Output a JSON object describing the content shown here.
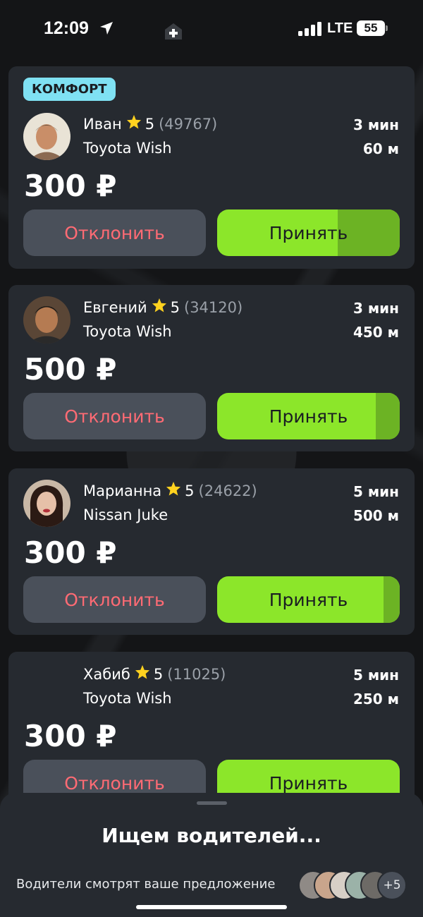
{
  "status_bar": {
    "time": "12:09",
    "network": "LTE",
    "battery": "55",
    "icons": [
      "location-arrow-icon",
      "medical-cross-icon",
      "signal-bars-icon",
      "battery-icon"
    ]
  },
  "offers": [
    {
      "badge": "КОМФОРТ",
      "driver_name": "Иван",
      "rating": "5",
      "rating_count": "(49767)",
      "car": "Toyota Wish",
      "eta": "3 мин",
      "distance": "60 м",
      "price": "300 ₽",
      "decline_label": "Отклонить",
      "accept_label": "Принять",
      "accept_timer_remaining": 0.34
    },
    {
      "driver_name": "Евгений",
      "rating": "5",
      "rating_count": "(34120)",
      "car": "Toyota Wish",
      "eta": "3 мин",
      "distance": "450 м",
      "price": "500 ₽",
      "decline_label": "Отклонить",
      "accept_label": "Принять",
      "accept_timer_remaining": 0.13
    },
    {
      "driver_name": "Марианна",
      "rating": "5",
      "rating_count": "(24622)",
      "car": "Nissan Juke",
      "eta": "5 мин",
      "distance": "500 м",
      "price": "300 ₽",
      "decline_label": "Отклонить",
      "accept_label": "Принять",
      "accept_timer_remaining": 0.09
    },
    {
      "driver_name": "Хабиб",
      "rating": "5",
      "rating_count": "(11025)",
      "car": "Toyota Wish",
      "eta": "5 мин",
      "distance": "250 м",
      "price": "300 ₽",
      "decline_label": "Отклонить",
      "accept_label": "Принять",
      "accept_timer_remaining": 0.0
    }
  ],
  "bottom_sheet": {
    "title": "Ищем водителей...",
    "subtitle": "Водители смотрят ваше предложение",
    "more_count": "+5"
  },
  "colors": {
    "accent_green": "#8ce62a",
    "decline_red": "#ff6b74",
    "badge_cyan": "#7fe1f3",
    "card_bg": "#262a30"
  }
}
